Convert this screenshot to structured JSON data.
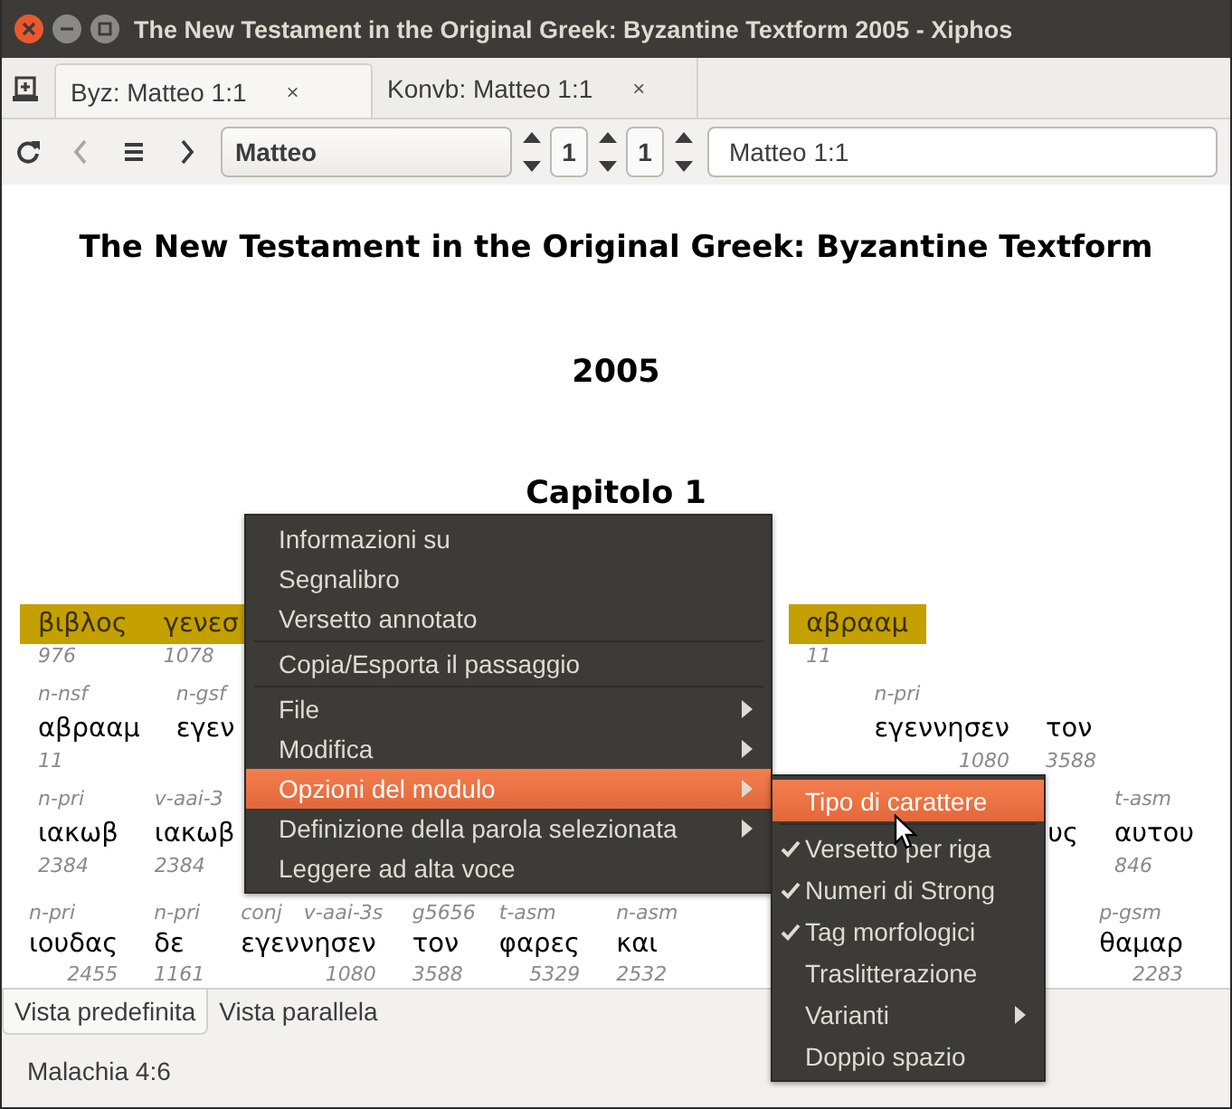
{
  "window": {
    "title": "The New Testament in the Original Greek: Byzantine Textform 2005 - Xiphos"
  },
  "tabs": [
    {
      "label": "Byz: Matteo 1:1",
      "close": "×",
      "selected": true
    },
    {
      "label": "Konvb: Matteo 1:1",
      "close": "×",
      "selected": false
    }
  ],
  "toolbar": {
    "nav_buttons": [
      {
        "kind": "refresh",
        "disabled": false
      },
      {
        "kind": "back",
        "disabled": true
      },
      {
        "kind": "history",
        "disabled": false
      },
      {
        "kind": "forward",
        "disabled": false
      }
    ],
    "book": "Matteo",
    "chapter": "1",
    "verse": "1",
    "reference": "Matteo 1:1"
  },
  "document": {
    "title": "The New Testament in the Original Greek: Byzantine Textform",
    "year": "2005",
    "chapter": "Capitolo 1",
    "rows": [
      {
        "highlighted": true,
        "left": [
          {
            "word": "βιβλος",
            "strong": "976"
          },
          {
            "word": "γενεσ",
            "strong": "1078"
          }
        ],
        "right": [
          {
            "word": "αβρααμ",
            "strong": "11"
          }
        ]
      },
      {
        "highlighted": false,
        "left": [
          {
            "tags": [
              "n-nsf"
            ],
            "word": "αβρααμ",
            "strong": "11"
          },
          {
            "tags": [
              "n-gsf"
            ],
            "word": "εγεν"
          }
        ],
        "right": [
          {
            "tags": [
              "n-pri"
            ],
            "word": "εγεννησεν",
            "strong": "1080"
          },
          {
            "word": "τον",
            "strong": "3588"
          }
        ]
      },
      {
        "highlighted": false,
        "left": [
          {
            "tags": [
              "n-pri"
            ],
            "word": "ιακωβ",
            "strong": "2384"
          },
          {
            "tags": [
              "v-aai-3"
            ],
            "word": "ιακωβ",
            "strong": "2384"
          }
        ],
        "right": [
          {
            "word": "υς"
          },
          {
            "tags": [
              "t-asm"
            ],
            "word": "αυτου",
            "strong": "846"
          }
        ]
      },
      {
        "highlighted": false,
        "left": [
          {
            "tags": [
              "n-pri"
            ],
            "word": "ιουδας",
            "strong": "2455"
          },
          {
            "tags": [
              "n-pri"
            ],
            "word": "δε",
            "strong": "1161"
          },
          {
            "tags": [
              "conj",
              "v-aai-3s"
            ],
            "word": "εγεννησεν",
            "strong": "1080"
          },
          {
            "tags": [
              "g5656"
            ],
            "word": "τον",
            "strong": "3588"
          },
          {
            "tags": [
              "t-asm"
            ],
            "word": "φαρες",
            "strong": "5329"
          },
          {
            "tags": [
              "n-asm"
            ],
            "word": "και",
            "strong": "2532"
          }
        ],
        "right": [
          {
            "tags": [
              "p-gsm"
            ],
            "word": "θαμαρ",
            "strong": "2283"
          }
        ]
      }
    ]
  },
  "context_menu": {
    "items": [
      {
        "kind": "item",
        "label": "Informazioni su",
        "submenu": false,
        "selected": false
      },
      {
        "kind": "item",
        "label": "Segnalibro",
        "submenu": false,
        "selected": false
      },
      {
        "kind": "item",
        "label": "Versetto annotato",
        "submenu": false,
        "selected": false
      },
      {
        "kind": "separator"
      },
      {
        "kind": "item",
        "label": "Copia/Esporta il passaggio",
        "submenu": false,
        "selected": false
      },
      {
        "kind": "separator"
      },
      {
        "kind": "item",
        "label": "File",
        "submenu": true,
        "selected": false
      },
      {
        "kind": "item",
        "label": "Modifica",
        "submenu": true,
        "selected": false
      },
      {
        "kind": "item",
        "label": "Opzioni del modulo",
        "submenu": true,
        "selected": true
      },
      {
        "kind": "item",
        "label": "Definizione della parola selezionata",
        "submenu": true,
        "selected": false
      },
      {
        "kind": "item",
        "label": "Leggere ad alta voce",
        "submenu": false,
        "selected": false
      }
    ]
  },
  "submenu": {
    "items": [
      {
        "kind": "item",
        "label": "Tipo di carattere",
        "checked": false,
        "submenu": false,
        "selected": true
      },
      {
        "kind": "separator"
      },
      {
        "kind": "item",
        "label": "Versetto per riga",
        "checked": true,
        "submenu": false,
        "selected": false
      },
      {
        "kind": "item",
        "label": "Numeri di Strong",
        "checked": true,
        "submenu": false,
        "selected": false
      },
      {
        "kind": "item",
        "label": "Tag morfologici",
        "checked": true,
        "submenu": false,
        "selected": false
      },
      {
        "kind": "item",
        "label": "Traslitterazione",
        "checked": false,
        "submenu": false,
        "selected": false
      },
      {
        "kind": "item",
        "label": "Varianti",
        "checked": false,
        "submenu": true,
        "selected": false
      },
      {
        "kind": "item",
        "label": "Doppio spazio",
        "checked": false,
        "submenu": false,
        "selected": false
      }
    ]
  },
  "bottom_tabs": [
    {
      "label": "Vista predefinita",
      "selected": true
    },
    {
      "label": "Vista parallela",
      "selected": false
    }
  ],
  "status_bar": "Malachia 4:6"
}
